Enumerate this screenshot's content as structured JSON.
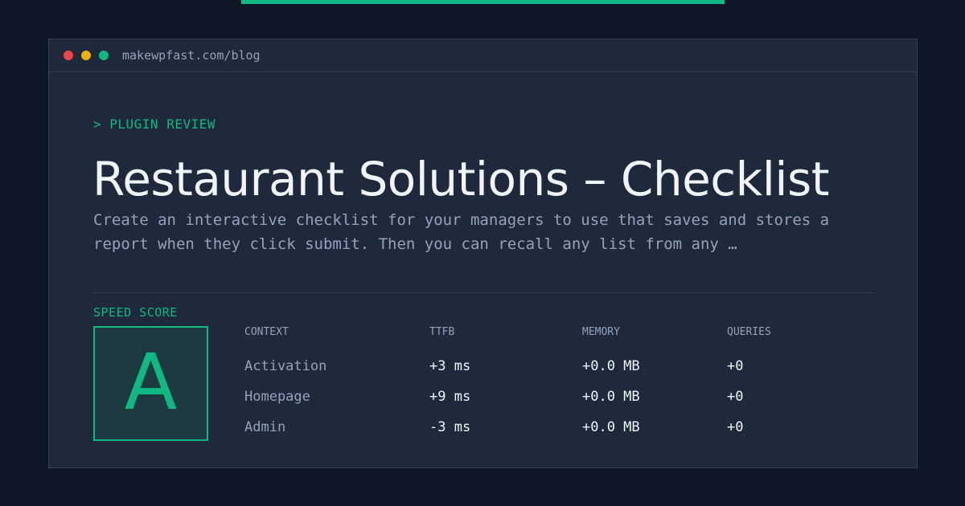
{
  "browser": {
    "url": "makewpfast.com/blog"
  },
  "post": {
    "eyebrow": "> PLUGIN REVIEW",
    "title": "Restaurant Solutions – Checklist",
    "excerpt_line1": "Create an interactive checklist for your managers to use that saves and stores a",
    "excerpt_line2": "report when they click submit. Then you can recall any list from any …"
  },
  "score": {
    "label": "SPEED SCORE",
    "grade": "A"
  },
  "metrics": {
    "headers": [
      "CONTEXT",
      "TTFB",
      "MEMORY",
      "QUERIES"
    ],
    "rows": [
      {
        "context": "Activation",
        "ttfb": "+3 ms",
        "memory": "+0.0 MB",
        "queries": "+0"
      },
      {
        "context": "Homepage",
        "ttfb": "+9 ms",
        "memory": "+0.0 MB",
        "queries": "+0"
      },
      {
        "context": "Admin",
        "ttfb": "-3 ms",
        "memory": "+0.0 MB",
        "queries": "+0"
      }
    ]
  },
  "colors": {
    "accent": "#10b981",
    "background": "#0e1628",
    "panel": "#1e293b"
  }
}
